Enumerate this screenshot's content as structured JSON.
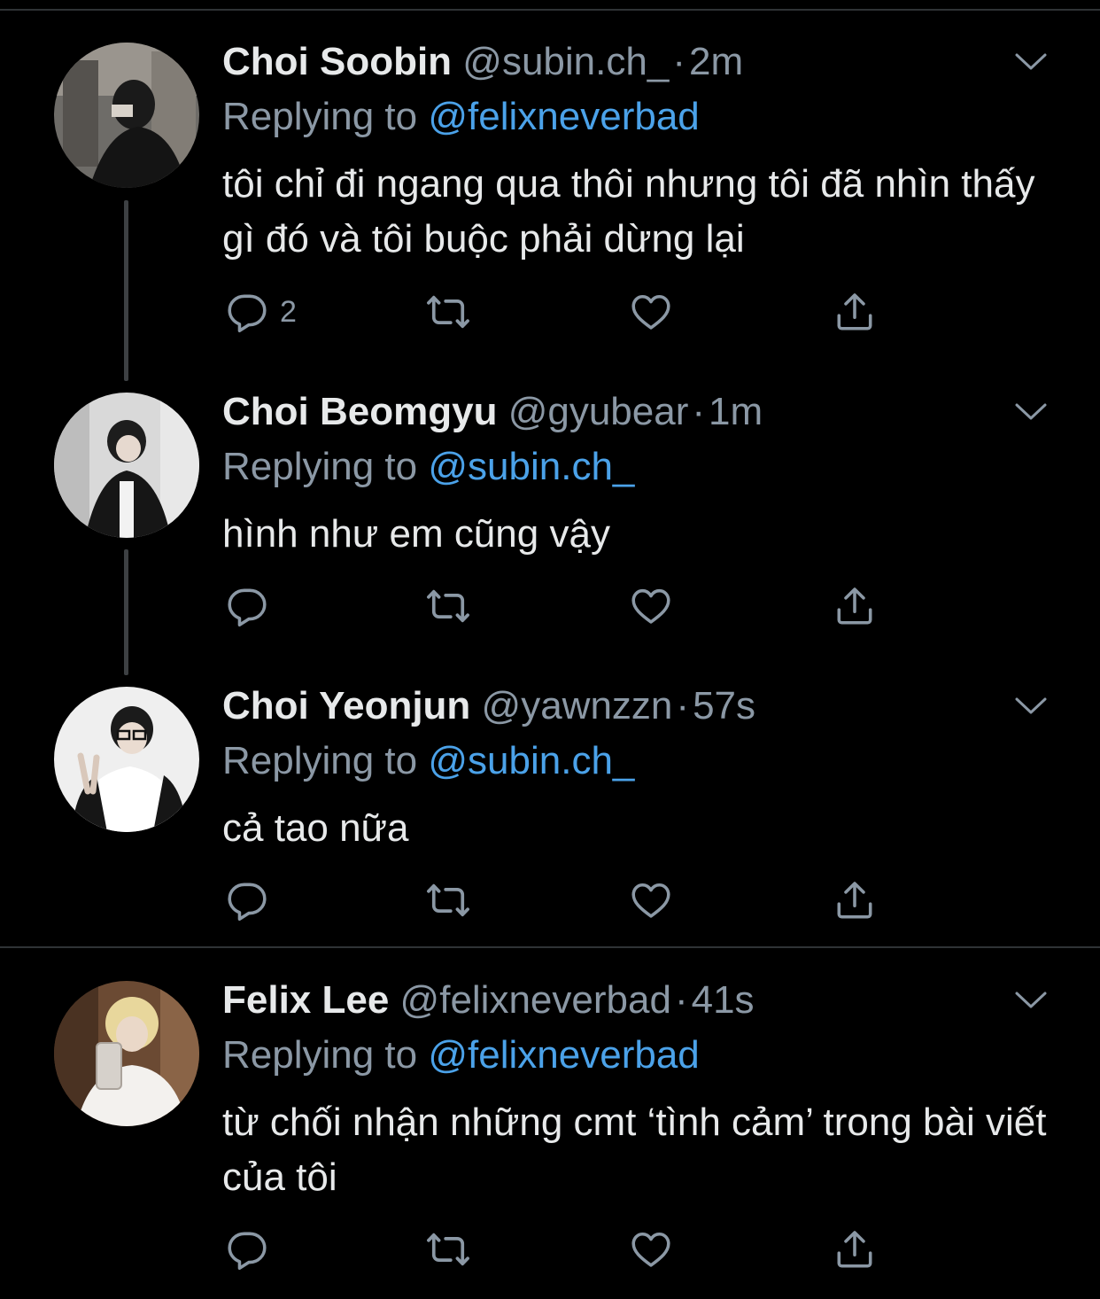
{
  "colors": {
    "background": "#000000",
    "divider": "#2f3336",
    "secondary_text": "#8b98a5",
    "mention": "#4ba2e9",
    "primary_text": "#e7e9ea"
  },
  "tweets": [
    {
      "name": "Choi Soobin",
      "handle": "@subin.ch_",
      "dot": "·",
      "time": "2m",
      "replying_label": "Replying to",
      "replying_to": "@felixneverbad",
      "text": "tôi chỉ đi ngang qua thôi nhưng tôi đã nhìn thấy gì đó và tôi buộc phải dừng lại",
      "reply_count": "2",
      "icons": [
        "reply-icon",
        "retweet-icon",
        "like-icon",
        "share-icon",
        "chevron-down-icon"
      ]
    },
    {
      "name": "Choi Beomgyu",
      "handle": "@gyubear",
      "dot": "·",
      "time": "1m",
      "replying_label": "Replying to",
      "replying_to": "@subin.ch_",
      "text": "hình như em cũng vậy",
      "reply_count": "",
      "icons": [
        "reply-icon",
        "retweet-icon",
        "like-icon",
        "share-icon",
        "chevron-down-icon"
      ]
    },
    {
      "name": "Choi Yeonjun",
      "handle": "@yawnzzn",
      "dot": "·",
      "time": "57s",
      "replying_label": "Replying to",
      "replying_to": "@subin.ch_",
      "text": "cả tao nữa",
      "reply_count": "",
      "icons": [
        "reply-icon",
        "retweet-icon",
        "like-icon",
        "share-icon",
        "chevron-down-icon"
      ]
    },
    {
      "name": "Felix Lee",
      "handle": "@felixneverbad",
      "dot": "·",
      "time": "41s",
      "replying_label": "Replying to",
      "replying_to": "@felixneverbad",
      "text": "từ chối nhận những cmt ‘tình cảm’ trong bài viết của tôi",
      "reply_count": "",
      "icons": [
        "reply-icon",
        "retweet-icon",
        "like-icon",
        "share-icon",
        "chevron-down-icon"
      ]
    }
  ]
}
